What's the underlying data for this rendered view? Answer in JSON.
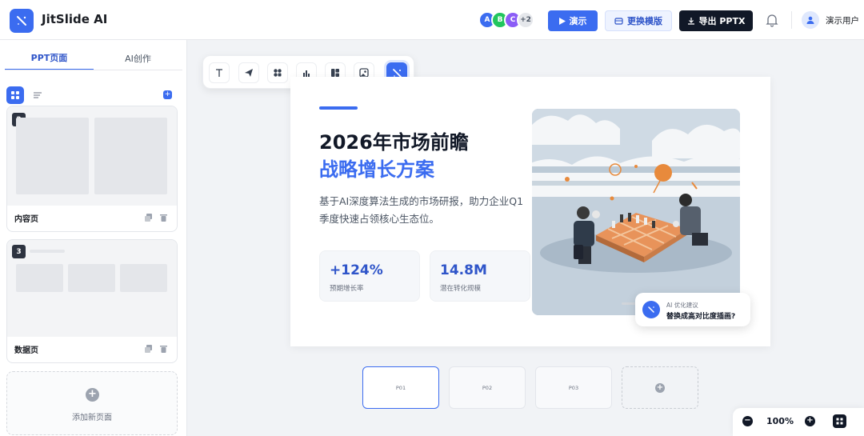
{
  "app": {
    "name": "JitSlide AI"
  },
  "header": {
    "collaborators": [
      {
        "initial": "A",
        "color": "#3b6cf0"
      },
      {
        "initial": "B",
        "color": "#22c55e"
      },
      {
        "initial": "C",
        "color": "#8b5cf6"
      }
    ],
    "more_collaborators": "+2",
    "present_label": "演示",
    "template_label": "更换模版",
    "export_label": "导出 PPTX",
    "user_name": "演示用户"
  },
  "sidebar": {
    "tabs": [
      {
        "label": "PPT页面",
        "active": true
      },
      {
        "label": "AI创作",
        "active": false
      }
    ],
    "slides": [
      {
        "number": "2",
        "title": "内容页"
      },
      {
        "number": "3",
        "title": "数据页"
      }
    ],
    "add_page_label": "添加新页面"
  },
  "toolbar": {
    "tools": [
      "text-icon",
      "send-icon",
      "shapes-icon",
      "chart-icon",
      "layout-icon",
      "image-icon",
      "magic-wand-icon"
    ]
  },
  "slide": {
    "title_line1": "2026年市场前瞻",
    "title_line2": "战略增长方案",
    "description": "基于AI深度算法生成的市场研报，助力企业Q1季度快速占领核心生态位。",
    "stats": [
      {
        "value": "+124%",
        "label": "预期增长率"
      },
      {
        "value": "14.8M",
        "label": "潜在转化规模"
      }
    ]
  },
  "ai_tip": {
    "heading": "AI 优化建议",
    "message": "替换成高对比度插画?"
  },
  "filmstrip": {
    "items": [
      "P01",
      "P02",
      "P03"
    ],
    "active": "P01"
  },
  "zoom": {
    "level": "100%"
  },
  "colors": {
    "accent": "#3b6cf0",
    "dark": "#111827"
  }
}
